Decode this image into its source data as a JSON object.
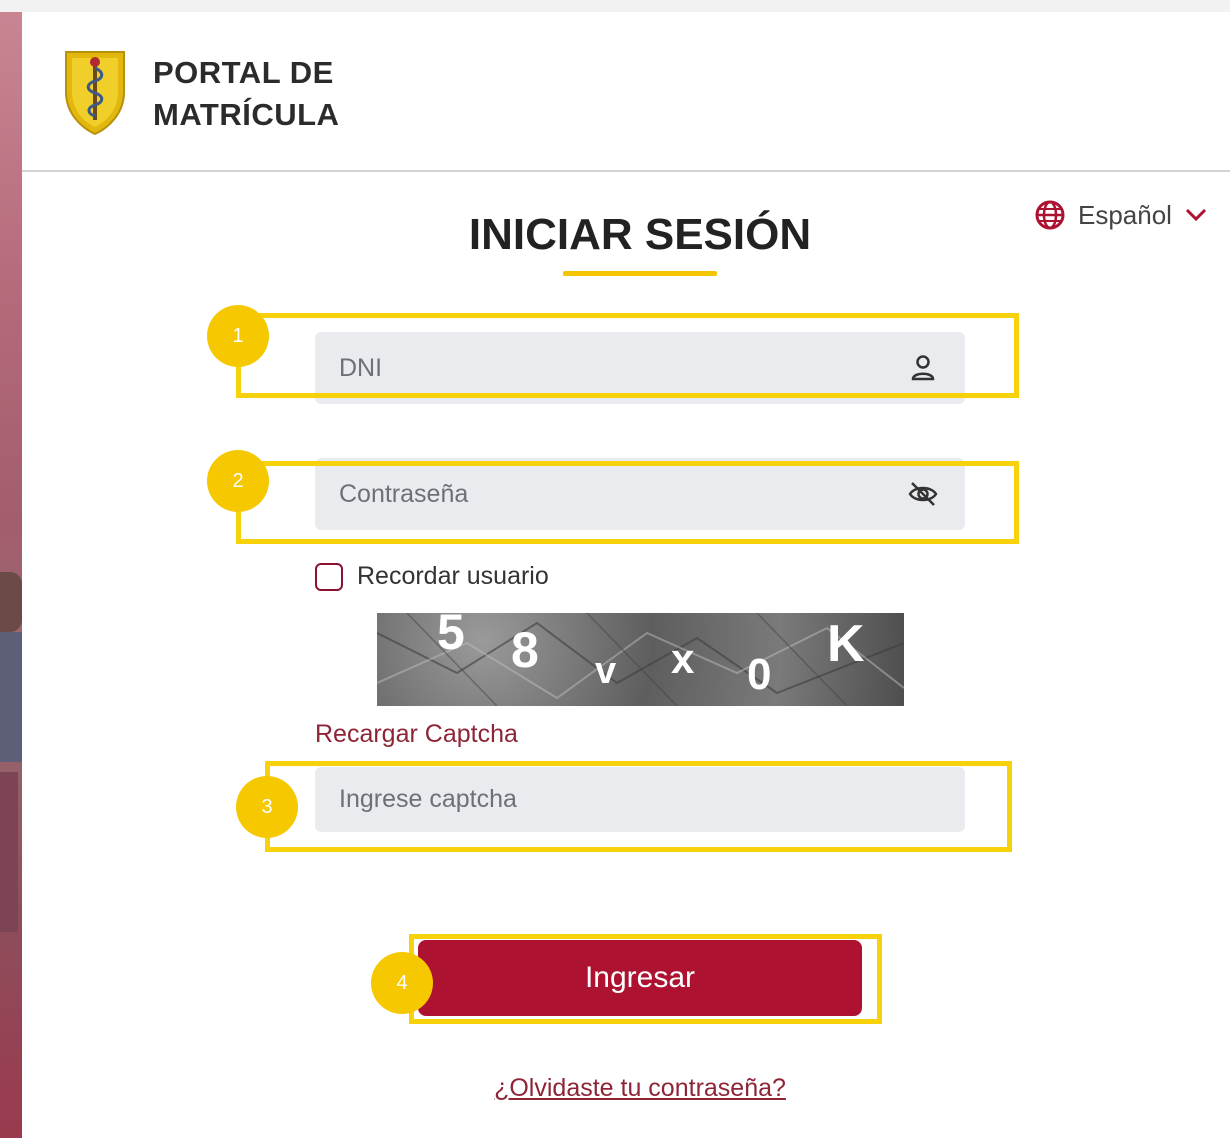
{
  "header": {
    "title_line1": "PORTAL DE",
    "title_line2": "MATRÍCULA"
  },
  "language": {
    "label": "Español",
    "icon": "globe-icon",
    "caret_icon": "chevron-down-icon"
  },
  "login": {
    "title": "INICIAR SESIÓN",
    "dni_placeholder": "DNI",
    "dni_icon": "user-icon",
    "password_placeholder": "Contraseña",
    "password_icon": "eye-off-icon",
    "remember_label": "Recordar usuario",
    "captcha_text": "58vx0K",
    "reload_captcha": "Recargar Captcha",
    "captcha_placeholder": "Ingrese captcha",
    "submit_label": "Ingresar",
    "forgot_password": "¿Olvidaste tu contraseña?"
  },
  "annotations": {
    "badge_1": "1",
    "badge_2": "2",
    "badge_3": "3",
    "badge_4": "4",
    "highlight_color": "#f7d20b",
    "badge_color": "#f5c800"
  },
  "colors": {
    "accent": "#ad1231",
    "link": "#8e2537",
    "title_underline": "#f4c400",
    "field_bg": "#e9ebee"
  }
}
